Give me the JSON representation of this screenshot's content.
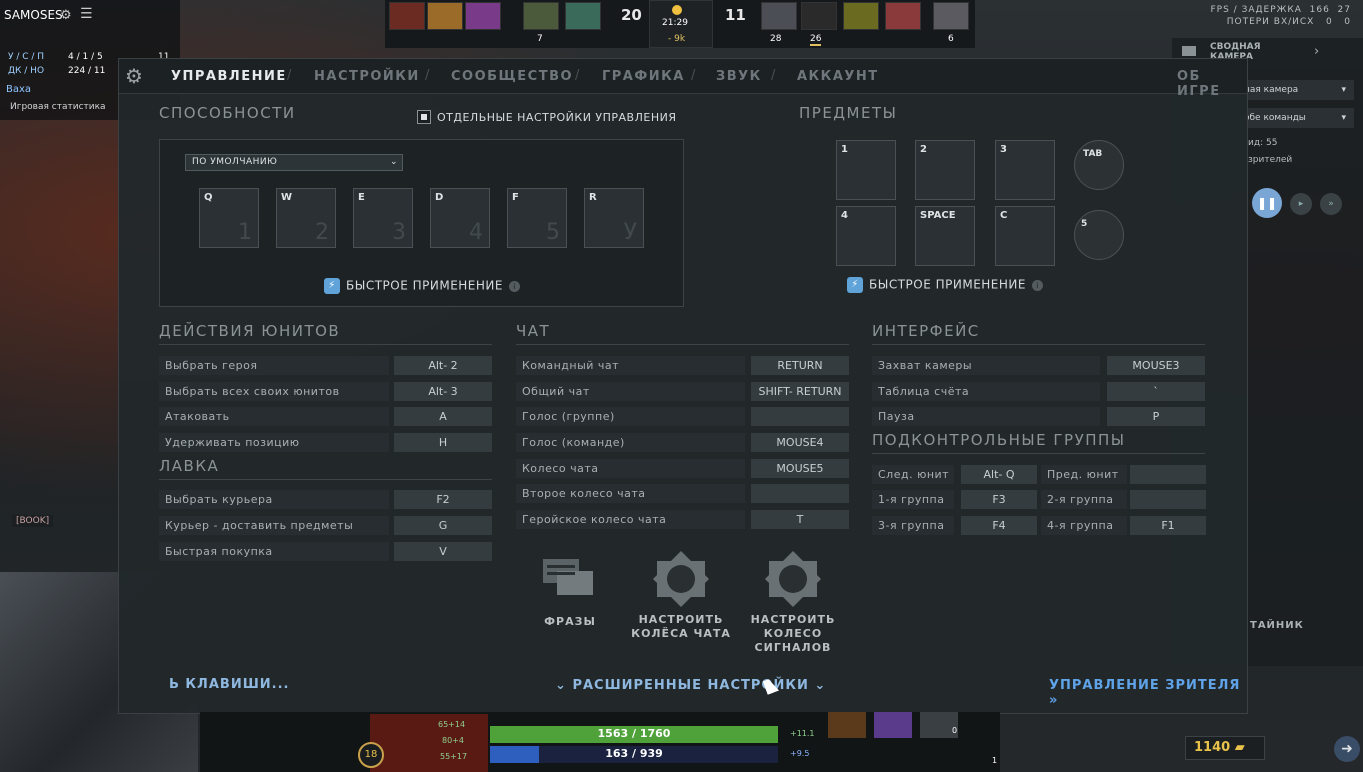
{
  "hud": {
    "player_name": "SAMOSES",
    "kda_label": "У / С / П",
    "kda_values": "4 / 1 / 5",
    "dn_label": "ДК / НО",
    "dn_values": "224 / 11",
    "side_number": "11",
    "teammate": "Baxa",
    "stats_link": "Игровая статистика",
    "score_radiant": "20",
    "score_dire": "11",
    "clock": "21:29",
    "gold_diff": "- 9k",
    "radiant_level": "7",
    "dire_level_1": "28",
    "dire_level_2": "26",
    "dire_level_3": "6",
    "fps_label": "FPS / ЗАДЕРЖКА",
    "fps_value": "166",
    "ping_value": "27",
    "loss_label": "ПОТЕРИ ВХ/ИСХ",
    "loss_in": "0",
    "loss_out": "0",
    "camera_title": "СВОДНАЯ КАМЕРА",
    "camera_mode": "ная камера",
    "camera_team": "обе команды",
    "viewers_line1": "ид: 55",
    "viewers_line2": "зрителей",
    "secret_label": "ТАЙНИК",
    "gold": "1140",
    "hp": "1563 / 1760",
    "hp_regen": "+11.1",
    "mana": "163 / 939",
    "mana_regen": "+9.5",
    "hero_level": "18",
    "dmg": "65+14",
    "armor": "80+4",
    "speed": "55+17",
    "minimap_tag": "[BOOK]",
    "item_charge": "0",
    "item_charge2": "1"
  },
  "nav": {
    "tabs": [
      "УПРАВЛЕНИЕ",
      "НАСТРОЙКИ",
      "СООБЩЕСТВО",
      "ГРАФИКА",
      "ЗВУК",
      "АККАУНТ"
    ],
    "about": "ОБ ИГРЕ"
  },
  "abilities": {
    "title": "СПОСОБНОСТИ",
    "separate_label": "ОТДЕЛЬНЫЕ НАСТРОЙКИ УПРАВЛЕНИЯ",
    "dropdown": "ПО УМОЛЧАНИЮ",
    "keys": [
      {
        "key": "Q",
        "num": "1"
      },
      {
        "key": "W",
        "num": "2"
      },
      {
        "key": "E",
        "num": "3"
      },
      {
        "key": "D",
        "num": "4"
      },
      {
        "key": "F",
        "num": "5"
      },
      {
        "key": "R",
        "num": "У"
      }
    ],
    "quick_cast": "БЫСТРОЕ ПРИМЕНЕНИЕ"
  },
  "items": {
    "title": "ПРЕДМЕТЫ",
    "slots": [
      "1",
      "2",
      "3",
      "4",
      "SPACE",
      "C"
    ],
    "tab_label": "TAB",
    "circle2_label": "5",
    "quick_cast": "БЫСТРОЕ ПРИМЕНЕНИЕ"
  },
  "unit_actions": {
    "title": "ДЕЙСТВИЯ ЮНИТОВ",
    "rows": [
      {
        "label": "Выбрать героя",
        "key": "Alt- 2"
      },
      {
        "label": "Выбрать всех своих юнитов",
        "key": "Alt- 3"
      },
      {
        "label": "Атаковать",
        "key": "A"
      },
      {
        "label": "Удерживать позицию",
        "key": "H"
      }
    ]
  },
  "shop": {
    "title": "ЛАВКА",
    "rows": [
      {
        "label": "Выбрать курьера",
        "key": "F2"
      },
      {
        "label": "Курьер - доставить предметы",
        "key": "G"
      },
      {
        "label": "Быстрая покупка",
        "key": "V"
      }
    ]
  },
  "chat": {
    "title": "ЧАТ",
    "rows": [
      {
        "label": "Командный чат",
        "key": "RETURN"
      },
      {
        "label": "Общий чат",
        "key": "SHIFT- RETURN"
      },
      {
        "label": "Голос (группе)",
        "key": ""
      },
      {
        "label": "Голос (команде)",
        "key": "MOUSE4"
      },
      {
        "label": "Колесо чата",
        "key": "MOUSE5"
      },
      {
        "label": "Второе колесо чата",
        "key": ""
      },
      {
        "label": "Геройское колесо чата",
        "key": "T"
      }
    ]
  },
  "interface": {
    "title": "ИНТЕРФЕЙС",
    "rows": [
      {
        "label": "Захват камеры",
        "key": "MOUSE3"
      },
      {
        "label": "Таблица счёта",
        "key": "`"
      },
      {
        "label": "Пауза",
        "key": "P"
      }
    ]
  },
  "control_groups": {
    "title": "ПОДКОНТРОЛЬНЫЕ ГРУППЫ",
    "rows": [
      {
        "l1": "След. юнит",
        "k1": "Alt- Q",
        "l2": "Пред. юнит",
        "k2": ""
      },
      {
        "l1": "1-я группа",
        "k1": "F3",
        "l2": "2-я группа",
        "k2": ""
      },
      {
        "l1": "3-я группа",
        "k1": "F4",
        "l2": "4-я группа",
        "k2": "F1"
      }
    ]
  },
  "bottom_buttons": {
    "phrases": "ФРАЗЫ",
    "chat_wheel_1": "НАСТРОИТЬ",
    "chat_wheel_2": "КОЛЁСА ЧАТА",
    "signal_1": "НАСТРОИТЬ",
    "signal_2": "КОЛЕСО",
    "signal_3": "СИГНАЛОВ"
  },
  "footer": {
    "keys_link": "Ь КЛАВИШИ...",
    "advanced": "РАСШИРЕННЫЕ НАСТРОЙКИ",
    "spectator": "УПРАВЛЕНИЕ ЗРИТЕЛЯ"
  },
  "colors": {
    "accent_blue": "#5fa3d8",
    "hp_green": "#4fa13a",
    "mana_blue": "#2e5fbf",
    "gold": "#e8c24a"
  }
}
